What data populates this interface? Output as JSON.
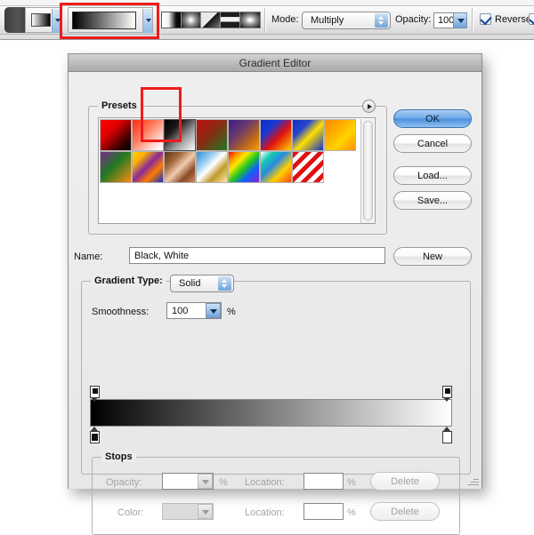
{
  "toolbar": {
    "tool_icon": "gradient-tool-icon",
    "gradient_preview_name": "Black, White",
    "gradient_types": [
      {
        "name": "linear-gradient-button",
        "label": "Linear Gradient",
        "selected": true
      },
      {
        "name": "radial-gradient-button",
        "label": "Radial Gradient",
        "selected": false
      },
      {
        "name": "angle-gradient-button",
        "label": "Angle Gradient",
        "selected": false
      },
      {
        "name": "reflected-gradient-button",
        "label": "Reflected Gradient",
        "selected": false
      },
      {
        "name": "diamond-gradient-button",
        "label": "Diamond Gradient",
        "selected": false
      }
    ],
    "mode_label": "Mode:",
    "mode_value": "Multiply",
    "opacity_label": "Opacity:",
    "opacity_value": "100%",
    "reverse_label": "Reverse",
    "reverse_checked": true
  },
  "dialog": {
    "title": "Gradient Editor",
    "presets": {
      "group_label": "Presets",
      "menu_icon": "presets-menu-icon",
      "selected_index": 2,
      "swatches": [
        {
          "label": "Foreground to Background",
          "css": "linear-gradient(135deg,#ff0000 0%,#e00000 35%,#3a0000 75%,#000000 100%)"
        },
        {
          "label": "Foreground to Transparent",
          "css": "linear-gradient(135deg,#ff2b10 0%,#ff7a5a 40%,rgba(255,120,90,0.25) 78%,rgba(255,255,255,0) 100%)"
        },
        {
          "label": "Black, White",
          "css": "linear-gradient(135deg,#000000 0%,#1a1a1a 30%,#9a9a9a 62%,#ffffff 100%)"
        },
        {
          "label": "Red, Green",
          "css": "linear-gradient(135deg,#c01010 0%,#8a2a14 45%,#1f7a22 100%)"
        },
        {
          "label": "Violet, Orange",
          "css": "linear-gradient(135deg,#3a1e8c 0%,#6b3a6b 38%,#c06a18 72%,#ff9a10 100%)"
        },
        {
          "label": "Blue, Red, Yellow",
          "css": "linear-gradient(135deg,#0b2fc0 0%,#1437d8 28%,#e01010 58%,#ffd000 100%)"
        },
        {
          "label": "Blue, Yellow, Blue",
          "css": "linear-gradient(135deg,#0b2fc0 0%,#2a46cf 30%,#ffe000 55%,#1030c8 100%)"
        },
        {
          "label": "Orange, Yellow, Orange",
          "css": "linear-gradient(135deg,#ff8a00 0%,#ffae00 35%,#ffd400 62%,#ff9000 100%)"
        },
        {
          "label": "Violet, Green, Orange",
          "css": "linear-gradient(135deg,#7a2a8c 0%,#1f7a22 45%,#ff8a10 100%)"
        },
        {
          "label": "Yellow, Violet, Orange, Blue",
          "css": "linear-gradient(135deg,#ffd000 0%,#ffb000 22%,#8a2a9a 48%,#ff7a00 70%,#1030c8 100%)"
        },
        {
          "label": "Copper",
          "css": "linear-gradient(135deg,#5a3218 0%,#a3663a 28%,#f0cbb0 52%,#8a4a26 76%,#c98a5e 100%)"
        },
        {
          "label": "Chrome",
          "css": "linear-gradient(135deg,#2f8ad6 0%,#9ed0f0 30%,#ffffff 48%,#c09a2a 70%,#ffe9a8 100%)"
        },
        {
          "label": "Spectrum",
          "css": "linear-gradient(135deg,#ff0000 0%,#ff8a00 16%,#ffe800 32%,#21c81f 52%,#1060ff 72%,#8a20d0 100%)"
        },
        {
          "label": "Transparent Rainbow",
          "css": "linear-gradient(135deg,rgba(255,255,255,0) 0%,#12c8b0 22%,#2a8ae0 42%,#ffd000 68%,#ff4a10 100%)"
        },
        {
          "label": "Transparent Stripes",
          "css": "repeating-linear-gradient(135deg,#e01010 0px,#e01010 5px,rgba(255,255,255,0.15) 5px,rgba(255,255,255,0.15) 10px)"
        }
      ]
    },
    "buttons": {
      "ok": "OK",
      "cancel": "Cancel",
      "load": "Load...",
      "save": "Save...",
      "new": "New"
    },
    "name_label": "Name:",
    "name_value": "Black, White",
    "gradient_type": {
      "group_label": "Gradient Type:",
      "value": "Solid"
    },
    "smoothness": {
      "label": "Smoothness:",
      "value": "100",
      "unit": "%"
    },
    "gradient_bar": {
      "css": "linear-gradient(to right,#000000,#ffffff)",
      "opacity_stops": [
        {
          "name": "opacity-stop-left",
          "position_pct": 0,
          "opacity": 100
        },
        {
          "name": "opacity-stop-right",
          "position_pct": 100,
          "opacity": 100
        }
      ],
      "color_stops": [
        {
          "name": "color-stop-left",
          "position_pct": 0,
          "color": "#000000"
        },
        {
          "name": "color-stop-right",
          "position_pct": 100,
          "color": "#ffffff"
        }
      ]
    },
    "stops": {
      "group_label": "Stops",
      "opacity_label": "Opacity:",
      "opacity_value": "",
      "opacity_unit": "%",
      "opacity_location_label": "Location:",
      "opacity_location_value": "",
      "opacity_location_unit": "%",
      "opacity_delete": "Delete",
      "color_label": "Color:",
      "color_value": "",
      "color_location_label": "Location:",
      "color_location_value": "",
      "color_location_unit": "%",
      "color_delete": "Delete"
    },
    "resize_grip": "resize-grip-icon"
  },
  "annotations": {
    "accent_color": "#ee1c1c",
    "boxes": [
      {
        "name": "annotation-gradient-preview",
        "target": "toolbar gradient preview swatch"
      },
      {
        "name": "annotation-preset-black-white",
        "target": "Black, White preset swatch"
      }
    ]
  }
}
